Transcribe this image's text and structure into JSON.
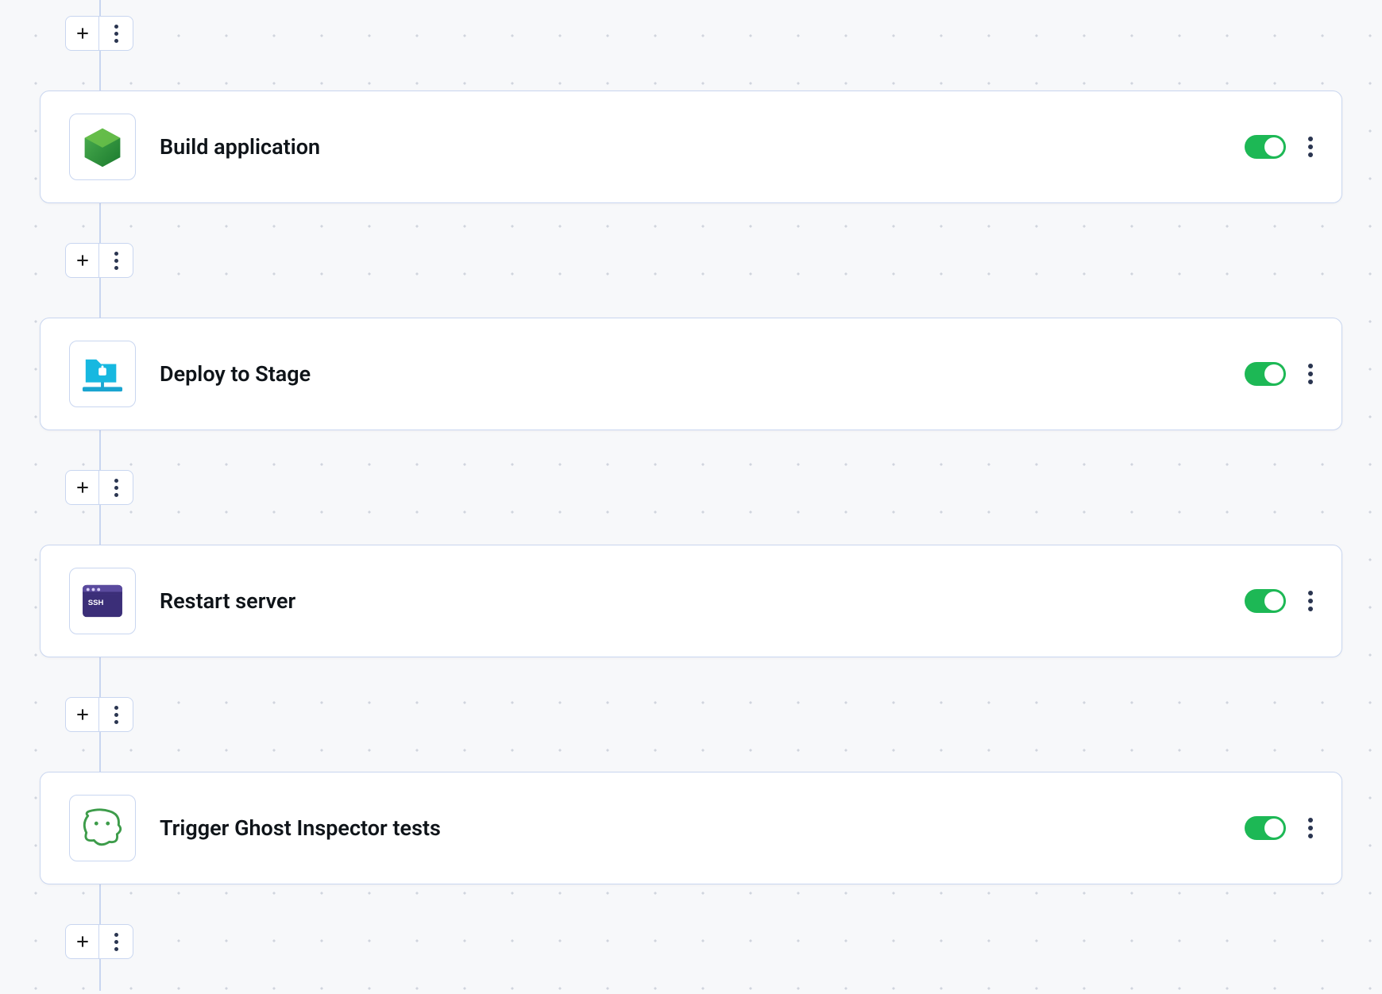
{
  "pipeline": {
    "steps": [
      {
        "title": "Build application",
        "icon": "node",
        "enabled": true
      },
      {
        "title": "Deploy to Stage",
        "icon": "deploy",
        "enabled": true
      },
      {
        "title": "Restart server",
        "icon": "ssh",
        "enabled": true
      },
      {
        "title": "Trigger Ghost Inspector tests",
        "icon": "ghost",
        "enabled": true
      }
    ]
  },
  "colors": {
    "border": "#c9d6f0",
    "toggle_on": "#1db855",
    "text": "#0f1419"
  }
}
